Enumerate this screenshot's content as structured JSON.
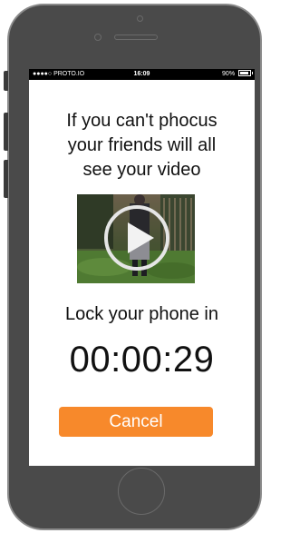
{
  "status_bar": {
    "carrier": "●●●●○ PROTO.IO",
    "time": "16:09",
    "battery": "90%",
    "battery_level": 0.9
  },
  "main": {
    "message_lines": [
      "If you can't phocus",
      "your friends will all",
      "see your video"
    ],
    "video_icon": "play-icon",
    "lock_label": "Lock your phone in",
    "countdown": "00:00:29",
    "cancel_label": "Cancel"
  },
  "colors": {
    "accent": "#f7892b",
    "device_body": "#4a4a4a",
    "status_bar": "#000000"
  }
}
